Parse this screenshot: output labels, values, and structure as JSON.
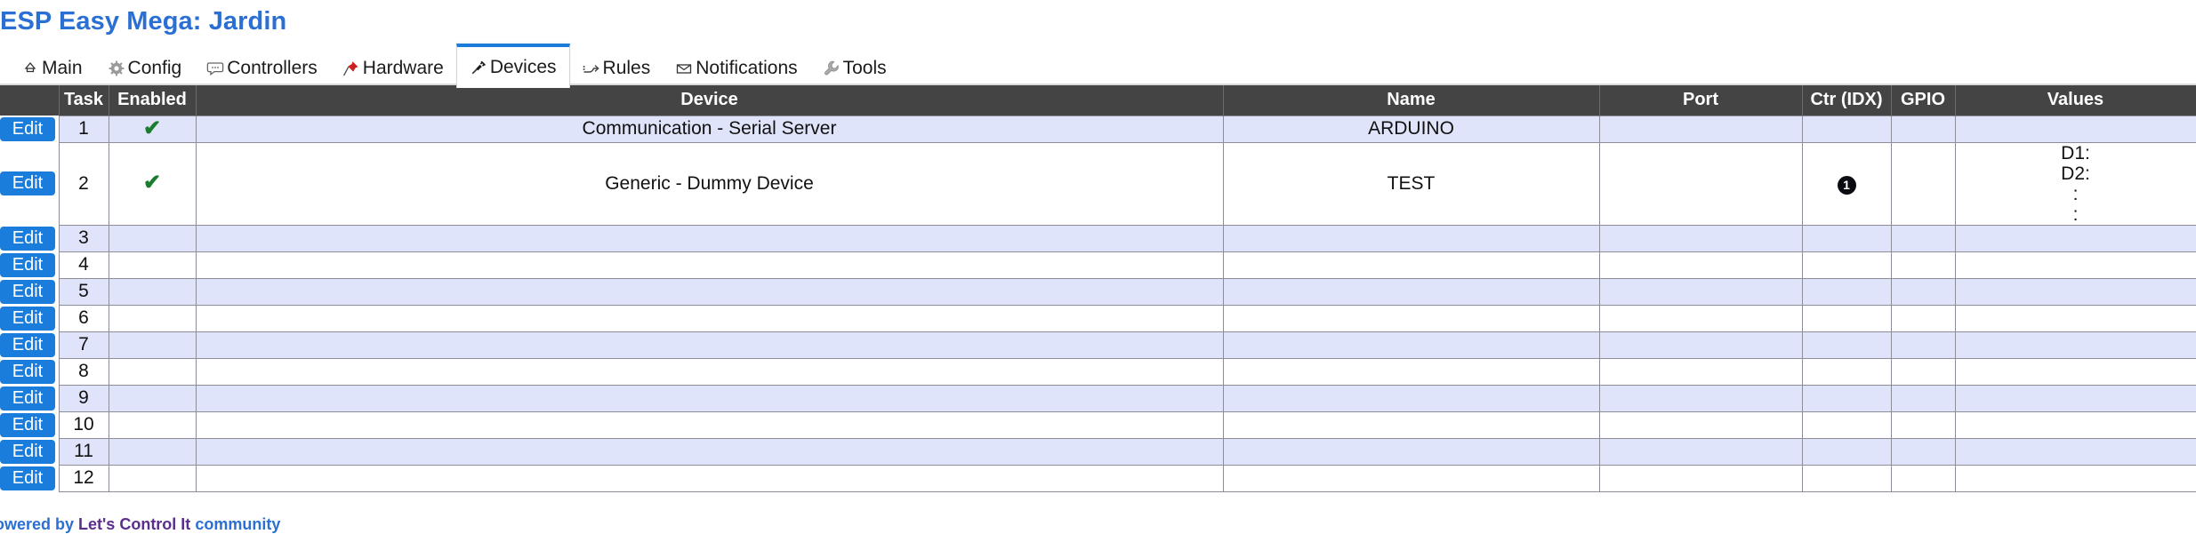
{
  "header": {
    "title": "ESP Easy Mega: Jardin"
  },
  "nav": {
    "items": [
      {
        "label": "Main",
        "icon": "home-icon",
        "active": false
      },
      {
        "label": "Config",
        "icon": "gear-icon",
        "active": false
      },
      {
        "label": "Controllers",
        "icon": "chat-bubble-icon",
        "active": false
      },
      {
        "label": "Hardware",
        "icon": "pin-icon",
        "active": false
      },
      {
        "label": "Devices",
        "icon": "plug-icon",
        "active": true
      },
      {
        "label": "Rules",
        "icon": "arrow-branch-icon",
        "active": false
      },
      {
        "label": "Notifications",
        "icon": "envelope-icon",
        "active": false
      },
      {
        "label": "Tools",
        "icon": "wrench-icon",
        "active": false
      }
    ]
  },
  "table": {
    "edit_label": "Edit",
    "columns": [
      "",
      "Task",
      "Enabled",
      "Device",
      "Name",
      "Port",
      "Ctr (IDX)",
      "GPIO",
      "Values"
    ],
    "rows": [
      {
        "task": "1",
        "enabled": "✔",
        "device": "Communication - Serial Server",
        "name": "ARDUINO",
        "port": "",
        "ctr": "",
        "gpio": "",
        "values": []
      },
      {
        "task": "2",
        "enabled": "✔",
        "device": "Generic - Dummy Device",
        "name": "TEST",
        "port": "",
        "ctr": "1",
        "gpio": "",
        "values": [
          "D1:",
          "D2:",
          ":",
          ":"
        ]
      },
      {
        "task": "3",
        "enabled": "",
        "device": "",
        "name": "",
        "port": "",
        "ctr": "",
        "gpio": "",
        "values": []
      },
      {
        "task": "4",
        "enabled": "",
        "device": "",
        "name": "",
        "port": "",
        "ctr": "",
        "gpio": "",
        "values": []
      },
      {
        "task": "5",
        "enabled": "",
        "device": "",
        "name": "",
        "port": "",
        "ctr": "",
        "gpio": "",
        "values": []
      },
      {
        "task": "6",
        "enabled": "",
        "device": "",
        "name": "",
        "port": "",
        "ctr": "",
        "gpio": "",
        "values": []
      },
      {
        "task": "7",
        "enabled": "",
        "device": "",
        "name": "",
        "port": "",
        "ctr": "",
        "gpio": "",
        "values": []
      },
      {
        "task": "8",
        "enabled": "",
        "device": "",
        "name": "",
        "port": "",
        "ctr": "",
        "gpio": "",
        "values": []
      },
      {
        "task": "9",
        "enabled": "",
        "device": "",
        "name": "",
        "port": "",
        "ctr": "",
        "gpio": "",
        "values": []
      },
      {
        "task": "10",
        "enabled": "",
        "device": "",
        "name": "",
        "port": "",
        "ctr": "",
        "gpio": "",
        "values": []
      },
      {
        "task": "11",
        "enabled": "",
        "device": "",
        "name": "",
        "port": "",
        "ctr": "",
        "gpio": "",
        "values": []
      },
      {
        "task": "12",
        "enabled": "",
        "device": "",
        "name": "",
        "port": "",
        "ctr": "",
        "gpio": "",
        "values": []
      }
    ]
  },
  "footer": {
    "prefix": "Powered by ",
    "brand": "Let's Control It",
    "suffix": " community"
  },
  "colors": {
    "accent": "#1a7ddb",
    "title": "#2a6fd4",
    "header_row": "#444444",
    "odd_row": "#e0e4fa",
    "check": "#1a7d2e",
    "brand": "#5b2d8e"
  }
}
